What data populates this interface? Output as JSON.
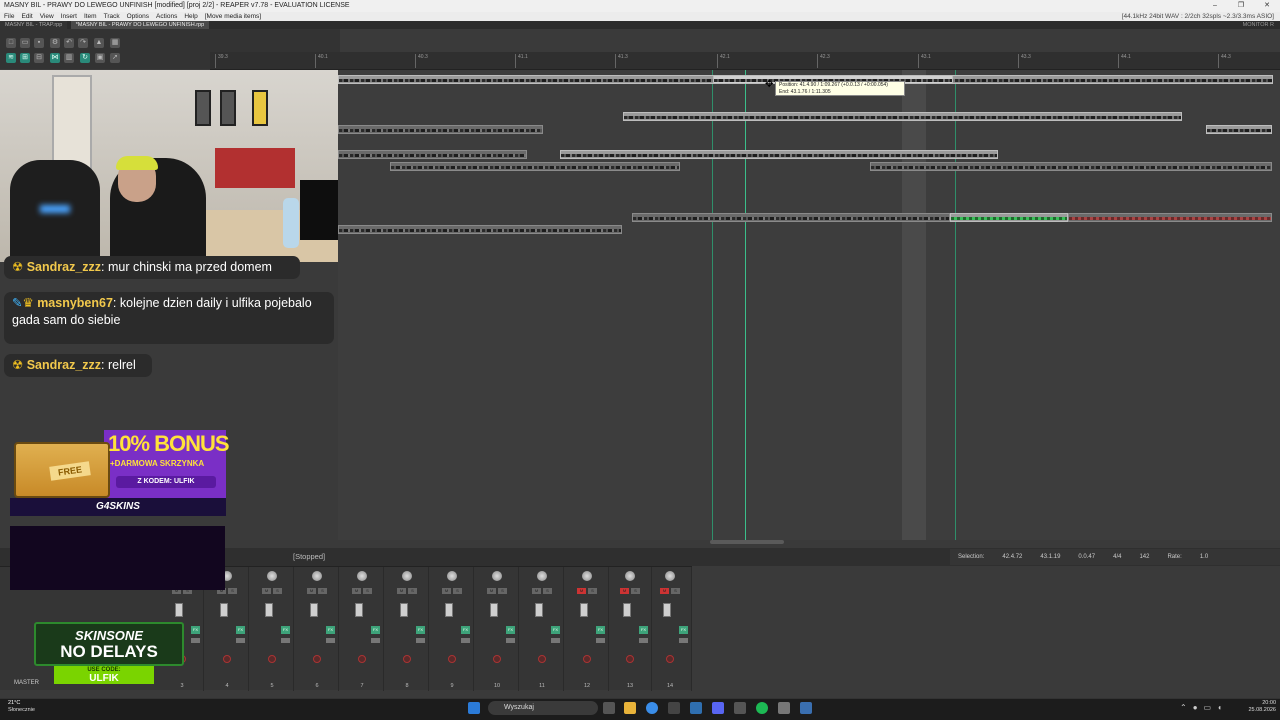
{
  "window": {
    "title": "MASNY BIL - PRAWY DO LEWEGO UNFINISH [modified] [proj 2/2] - REAPER v7.78 - EVALUATION LICENSE",
    "minimize": "–",
    "maximize": "❐",
    "close": "✕"
  },
  "menu": {
    "items": [
      "File",
      "Edit",
      "View",
      "Insert",
      "Item",
      "Track",
      "Options",
      "Actions",
      "Help",
      "[Move media items]"
    ],
    "audio_status": "[44.1kHz 24bit WAV : 2/2ch 32spls ~2.3/3.3ms ASIO]"
  },
  "tabs": {
    "items": [
      "MASNY BIL - TRAP.rpp",
      "*MASNY BIL - PRAWY DO LEWEGO UNFINISH.rpp"
    ],
    "monitor": "MONITOR R"
  },
  "ruler": {
    "ticks": [
      "39.3",
      "40.1",
      "40.3",
      "41.1",
      "41.3",
      "42.1",
      "42.3",
      "43.1",
      "43.3",
      "44.1",
      "44.3"
    ]
  },
  "tooltip": {
    "line1": "Position: 41.4.90 / 1:09.267 (+0.0.13 / +0:00.054)",
    "line2": "End: 43.1.76 / 1:11.305"
  },
  "transport": {
    "status": "[Stopped]"
  },
  "selection": {
    "label": "Selection:",
    "start": "42.4.72",
    "end": "43.1.19",
    "length": "0.0.47",
    "time_sig": "4/4",
    "bpm": "142",
    "rate_label": "Rate:",
    "rate": "1.0"
  },
  "mixer": {
    "master_label": "MASTER",
    "tracks": [
      "3",
      "4",
      "5",
      "6",
      "7",
      "8",
      "9",
      "10",
      "11",
      "12",
      "13",
      "14"
    ]
  },
  "chat": {
    "messages": [
      {
        "user": "Sandraz_zzz",
        "text": ": mur chinski ma przed domem"
      },
      {
        "user": "masnyben67",
        "text": ": kolejne dzien daily i ulfika pojebalo gada sam do siebie"
      },
      {
        "user": "Sandraz_zzz",
        "text": ": relrel"
      }
    ]
  },
  "promo1": {
    "crate_label": "FREE",
    "headline": "10% BONUS",
    "subline": "+DARMOWA SKRZYNKA",
    "code": "Z KODEM: ULFIK",
    "brand": "G4SKINS"
  },
  "promo2": {
    "line1": "SKINSONE",
    "line2": "NO DELAYS",
    "use_code": "USE CODE:",
    "code": "ULFIK"
  },
  "taskbar": {
    "temperature": "21°C",
    "weather": "Słonecznie",
    "search": "Wyszukaj",
    "time": "20:00",
    "date": "25.08.2026"
  },
  "colors": {
    "accent": "#2a8a7a",
    "chat_user": "#f2c94c",
    "promo_purple": "#7a2fc6",
    "promo_green": "#7ad400"
  }
}
